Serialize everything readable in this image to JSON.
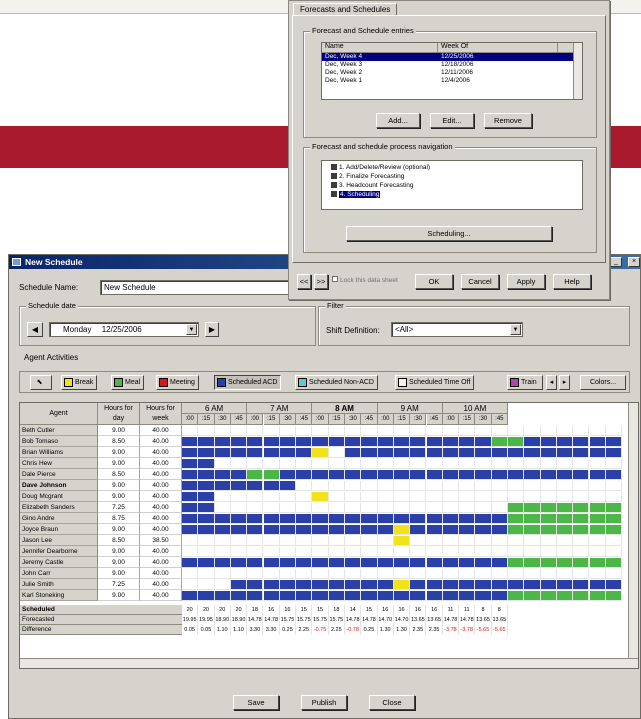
{
  "forecast_dialog": {
    "tab": "Forecasts and Schedules",
    "group1": "Forecast and Schedule entries",
    "columns": [
      "Name",
      "Week Of"
    ],
    "rows": [
      {
        "name": "Dec, Week 4",
        "week": "12/25/2006"
      },
      {
        "name": "Dec, Week 3",
        "week": "12/18/2006"
      },
      {
        "name": "Dec, Week 2",
        "week": "12/11/2006"
      },
      {
        "name": "Dec, Week 1",
        "week": "12/4/2006"
      }
    ],
    "add": "Add...",
    "edit": "Edit...",
    "remove": "Remove",
    "group2": "Forecast and schedule process navigation",
    "steps": [
      "1. Add/Delete/Review (optional)",
      "2. Finalize Forecasting",
      "3. Headcount Forecasting",
      "4. Scheduling"
    ],
    "scheduling_btn": "Scheduling...",
    "lock": "Lock this data sheet",
    "ok": "OK",
    "cancel": "Cancel",
    "apply": "Apply",
    "help": "Help"
  },
  "window": {
    "title": "New Schedule",
    "name_label": "Schedule Name:",
    "name_value": "New Schedule",
    "date_group": "Schedule date",
    "day": "Monday",
    "date": "12/25/2006",
    "filter_group": "Filter",
    "shift_label": "Shift Definition:",
    "shift_value": "<All>",
    "activities_group": "Agent Activities",
    "colors_btn": "Colors...",
    "save": "Save",
    "publish": "Publish",
    "close": "Close"
  },
  "activities": [
    {
      "label": "Break",
      "color": "#f2e21a"
    },
    {
      "label": "Meal",
      "color": "#4cb648"
    },
    {
      "label": "Meeting",
      "color": "#d21a1a"
    },
    {
      "label": "Scheduled ACD",
      "color": "#2b3fa8"
    },
    {
      "label": "Scheduled Non-ACD",
      "color": "#5ec9d6"
    },
    {
      "label": "Scheduled Time Off",
      "color": "#f4f2ec"
    },
    {
      "label": "Train",
      "color": "#b044a8"
    }
  ],
  "grid": {
    "agent_header": "Agent",
    "day_header": "Hours for day",
    "week_header": "Hours for week",
    "hours": [
      "6 AM",
      "7 AM",
      "8 AM",
      "9 AM",
      "10 AM"
    ],
    "minutes": [
      ":00",
      ":15",
      ":30",
      ":45"
    ],
    "agents": [
      {
        "name": "Beth Cutler",
        "day": "9.00",
        "week": "40.00",
        "row": "11111111111111111111111"
      },
      {
        "name": "Bob Tomaso",
        "day": "8.50",
        "week": "40.00",
        "row": "22222222222222222223322"
      },
      {
        "name": "Brian Williams",
        "day": "9.00",
        "week": "40.00",
        "row": "22222222112222222222222"
      },
      {
        "name": "Chris Hew",
        "day": "9.00",
        "week": "40.00",
        "row": "22000000000000000000000"
      },
      {
        "name": "Dale Pierce",
        "day": "8.50",
        "week": "40.00",
        "row": "22223322222222222222222"
      },
      {
        "name": "Dave Johnson",
        "day": "9.00",
        "week": "40.00",
        "row": "22222220000000000000000"
      },
      {
        "name": "Doug Mcgrant",
        "day": "9.00",
        "week": "40.00",
        "row": "22000000000000000000000"
      },
      {
        "name": "Elizabeth Sanders",
        "day": "7.25",
        "week": "40.00",
        "row": "22000000000000000000333"
      },
      {
        "name": "Gino Andre",
        "day": "8.75",
        "week": "40.00",
        "row": "22222222222222222222333"
      },
      {
        "name": "Joyce Braun",
        "day": "9.00",
        "week": "40.00",
        "row": "22222222222222222222333"
      },
      {
        "name": "Jason Lee",
        "day": "8.50",
        "week": "38.50",
        "row": "11111111111111111111111"
      },
      {
        "name": "Jennifer Dearborne",
        "day": "9.00",
        "week": "40.00",
        "row": "11111111111111111111111"
      },
      {
        "name": "Jeremy Castle",
        "day": "9.00",
        "week": "40.00",
        "row": "22222222222222222222333"
      },
      {
        "name": "John Carr",
        "day": "9.00",
        "week": "40.00",
        "row": "11111111111111111111111"
      },
      {
        "name": "Julie Smith",
        "day": "7.25",
        "week": "40.00",
        "row": "11122222222222222222222"
      },
      {
        "name": "Karl Stoneking",
        "day": "9.00",
        "week": "40.00",
        "row": "22222222222222222222333"
      }
    ],
    "break_marks": [
      [
        2,
        8
      ],
      [
        6,
        8
      ],
      [
        9,
        13
      ],
      [
        10,
        13
      ],
      [
        14,
        13
      ]
    ],
    "summary_labels": [
      "Scheduled",
      "Forecasted",
      "Difference"
    ],
    "scheduled": [
      "20",
      "20",
      "20",
      "20",
      "18",
      "16",
      "16",
      "15",
      "15",
      "18",
      "14",
      "15",
      "16",
      "16",
      "16",
      "16",
      "11",
      "11",
      "8",
      "8"
    ],
    "forecasted": [
      "19.95",
      "19.95",
      "18.90",
      "18.90",
      "14.78",
      "14.78",
      "15.75",
      "15.75",
      "15.75",
      "15.75",
      "14.78",
      "14.78",
      "14.70",
      "14.70",
      "13.65",
      "13.65",
      "14.78",
      "14.78",
      "13.65",
      "13.65"
    ],
    "difference": [
      "0.05",
      "0.05",
      "1.10",
      "1.10",
      "3.30",
      "3.30",
      "0.25",
      "2.25",
      "-0.75",
      "2.25",
      "-0.78",
      "0.25",
      "1.30",
      "1.30",
      "2.35",
      "2.35",
      "-3.78",
      "-3.78",
      "-5.65",
      "-5.65"
    ]
  }
}
